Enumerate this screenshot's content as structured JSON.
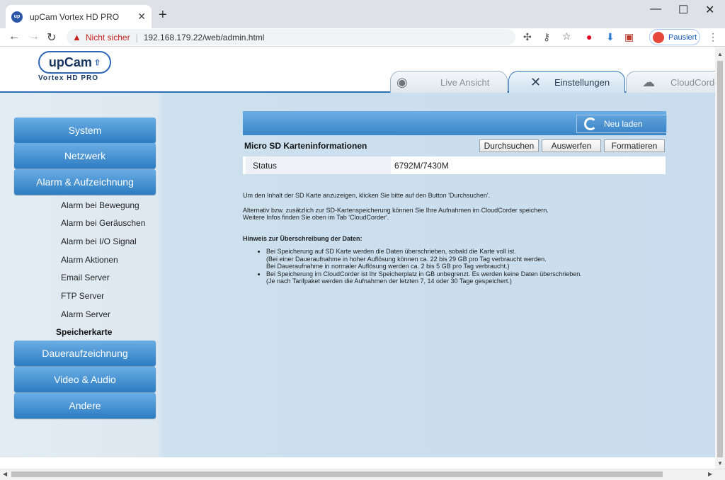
{
  "browser": {
    "tab_title": "upCam Vortex HD PRO",
    "tab_close": "✕",
    "new_tab": "+",
    "security_label": "Nicht sicher",
    "url": "192.168.179.22/web/admin.html",
    "profile_label": "Pausiert"
  },
  "header": {
    "logo_text": "upCam",
    "logo_sub": "Vortex HD PRO",
    "tabs": [
      {
        "label": "Live Ansicht",
        "icon": "eye-icon"
      },
      {
        "label": "Einstellungen",
        "icon": "tools-icon"
      },
      {
        "label": "CloudCorder",
        "icon": "cloud-icon"
      }
    ]
  },
  "sidebar": {
    "main_items": [
      "System",
      "Netzwerk",
      "Alarm & Aufzeichnung",
      "Daueraufzeichnung",
      "Video & Audio",
      "Andere"
    ],
    "sub_items": [
      "Alarm bei Bewegung",
      "Alarm bei Geräuschen",
      "Alarm bei I/O Signal",
      "Alarm Aktionen",
      "Email Server",
      "FTP Server",
      "Alarm Server",
      "Speicherkarte"
    ]
  },
  "main": {
    "reload_label": "Neu laden",
    "section_title": "Micro SD Karteninformationen",
    "buttons": [
      "Durchsuchen",
      "Auswerfen",
      "Formatieren"
    ],
    "status_label": "Status",
    "status_value": "6792M/7430M",
    "info1": "Um den Inhalt der SD Karte anzuzeigen, klicken Sie bitte auf den Button 'Durchsuchen'.",
    "info2": "Alternativ bzw. zusätzlich zur SD-Kartenspeicherung können Sie Ihre Aufnahmen im CloudCorder speichern.",
    "info3": "Weitere Infos finden Sie oben im Tab 'CloudCorder'.",
    "hint_title": "Hinweis zur Überschreibung der Daten:",
    "hint_items": [
      {
        "line1": "Bei Speicherung auf SD Karte werden die Daten überschrieben, sobald die Karte voll ist.",
        "line2": "(Bei einer Daueraufnahme in hoher Auflösung können ca. 22 bis 29 GB pro Tag verbraucht werden.",
        "line3": "Bei Daueraufnahme in normaler Auflösung werden ca. 2 bis 5 GB pro Tag verbraucht.)"
      },
      {
        "line1": "Bei Speicherung im CloudCorder ist Ihr Speicherplatz in GB unbegrenzt. Es werden keine Daten überschrieben.",
        "line2": "(Je nach Tarifpaket werden die Aufnahmen der letzten 7, 14 oder 30 Tage gespeichert.)"
      }
    ]
  }
}
